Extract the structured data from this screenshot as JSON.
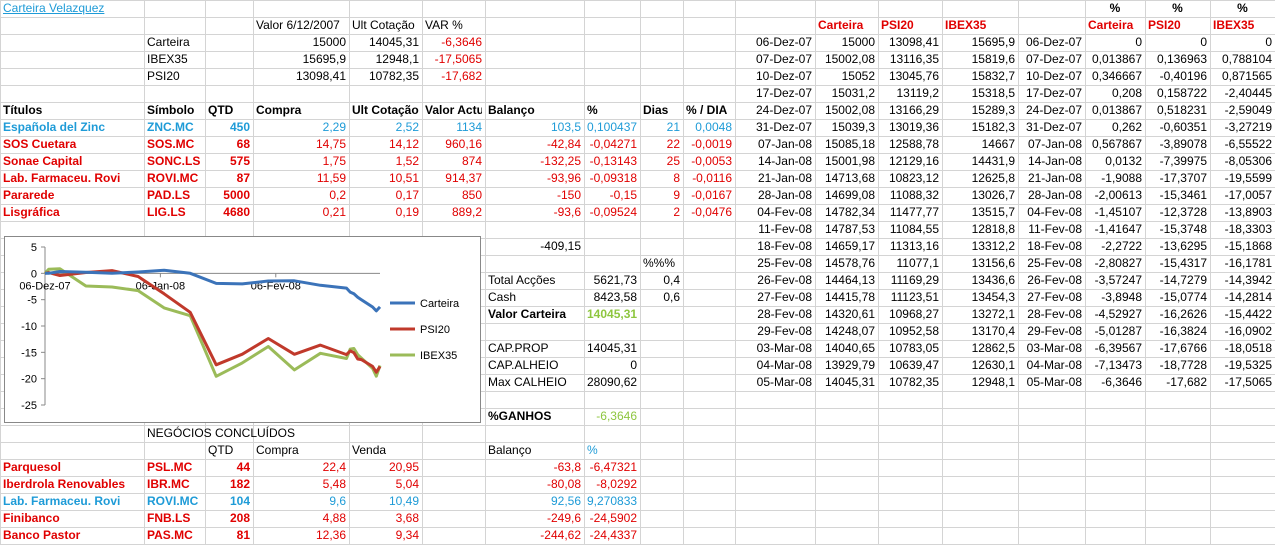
{
  "title": "Carteira Velazquez",
  "summary": {
    "headers": [
      "Valor 6/12/2007",
      "Ult Cotação",
      "VAR %"
    ],
    "rows": [
      {
        "name": "Carteira",
        "valor": "15000",
        "ult": "14045,31",
        "var": "-6,3646"
      },
      {
        "name": "IBEX35",
        "valor": "15695,9",
        "ult": "12948,1",
        "var": "-17,5065"
      },
      {
        "name": "PSI20",
        "valor": "13098,41",
        "ult": "10782,35",
        "var": "-17,682"
      }
    ]
  },
  "titles_headers": [
    "Títulos",
    "Símbolo",
    "QTD",
    "Compra",
    "Ult Cotação",
    "Valor Actual",
    "Balanço",
    "%",
    "Dias",
    "% / DIA"
  ],
  "titles": [
    {
      "name": "Española del Zinc",
      "sym": "ZNC.MC",
      "qtd": "450",
      "compra": "2,29",
      "ult": "2,52",
      "valor": "1134",
      "bal": "103,5",
      "pct": "0,100437",
      "dias": "21",
      "pd": "0,0048",
      "color": "blue"
    },
    {
      "name": "SOS Cuetara",
      "sym": "SOS.MC",
      "qtd": "68",
      "compra": "14,75",
      "ult": "14,12",
      "valor": "960,16",
      "bal": "-42,84",
      "pct": "-0,04271",
      "dias": "22",
      "pd": "-0,0019",
      "color": "red"
    },
    {
      "name": "Sonae Capital",
      "sym": "SONC.LS",
      "qtd": "575",
      "compra": "1,75",
      "ult": "1,52",
      "valor": "874",
      "bal": "-132,25",
      "pct": "-0,13143",
      "dias": "25",
      "pd": "-0,0053",
      "color": "red"
    },
    {
      "name": "Lab. Farmaceu. Rovi",
      "sym": "ROVI.MC",
      "qtd": "87",
      "compra": "11,59",
      "ult": "10,51",
      "valor": "914,37",
      "bal": "-93,96",
      "pct": "-0,09318",
      "dias": "8",
      "pd": "-0,0116",
      "color": "red"
    },
    {
      "name": "Pararede",
      "sym": "PAD.LS",
      "qtd": "5000",
      "compra": "0,2",
      "ult": "0,17",
      "valor": "850",
      "bal": "-150",
      "pct": "-0,15",
      "dias": "9",
      "pd": "-0,0167",
      "color": "red"
    },
    {
      "name": "Lisgráfica",
      "sym": "LIG.LS",
      "qtd": "4680",
      "compra": "0,21",
      "ult": "0,19",
      "valor": "889,2",
      "bal": "-93,6",
      "pct": "-0,09524",
      "dias": "2",
      "pd": "-0,0476",
      "color": "red"
    }
  ],
  "totals": {
    "balance_sum": "-409,15",
    "pctpct_label": "%%%",
    "rows": [
      {
        "label": "Total Acções",
        "value": "5621,73",
        "extra": "0,4"
      },
      {
        "label": "Cash",
        "value": "8423,58",
        "extra": "0,6"
      }
    ],
    "valor_label": "Valor Carteira",
    "valor_value": "14045,31",
    "cap": [
      {
        "label": "CAP.PROP",
        "value": "14045,31"
      },
      {
        "label": "CAP.ALHEIO",
        "value": "0"
      },
      {
        "label": "Max CALHEIO",
        "value": "28090,62"
      }
    ],
    "ganhos_label": "%GANHOS",
    "ganhos_value": "-6,3646"
  },
  "closed": {
    "title": "NEGÓCIOS CONCLUÍDOS",
    "headers": [
      "QTD",
      "Compra",
      "Venda",
      "Balanço",
      "%"
    ],
    "rows": [
      {
        "name": "Parquesol",
        "sym": "PSL.MC",
        "qtd": "44",
        "compra": "22,4",
        "venda": "20,95",
        "bal": "-63,8",
        "pct": "-6,47321",
        "color": "red"
      },
      {
        "name": "Iberdrola Renovables",
        "sym": "IBR.MC",
        "qtd": "182",
        "compra": "5,48",
        "venda": "5,04",
        "bal": "-80,08",
        "pct": "-8,0292",
        "color": "red"
      },
      {
        "name": "Lab. Farmaceu. Rovi",
        "sym": "ROVI.MC",
        "qtd": "104",
        "compra": "9,6",
        "venda": "10,49",
        "bal": "92,56",
        "pct": "9,270833",
        "color": "blue"
      },
      {
        "name": "Finibanco",
        "sym": "FNB.LS",
        "qtd": "208",
        "compra": "4,88",
        "venda": "3,68",
        "bal": "-249,6",
        "pct": "-24,5902",
        "color": "red"
      },
      {
        "name": "Banco Pastor",
        "sym": "PAS.MC",
        "qtd": "81",
        "compra": "12,36",
        "venda": "9,34",
        "bal": "-244,62",
        "pct": "-24,4337",
        "color": "red"
      }
    ]
  },
  "history": {
    "headers": [
      "Carteira",
      "PSI20",
      "IBEX35"
    ],
    "pct_headers": [
      "%",
      "%",
      "%"
    ],
    "rows": [
      {
        "date": "06-Dez-07",
        "c": "15000",
        "p": "13098,41",
        "i": "15695,9",
        "date2": "06-Dez-07",
        "pc": "0",
        "pp": "0",
        "pi": "0"
      },
      {
        "date": "07-Dez-07",
        "c": "15002,08",
        "p": "13116,35",
        "i": "15819,6",
        "date2": "07-Dez-07",
        "pc": "0,013867",
        "pp": "0,136963",
        "pi": "0,788104"
      },
      {
        "date": "10-Dez-07",
        "c": "15052",
        "p": "13045,76",
        "i": "15832,7",
        "date2": "10-Dez-07",
        "pc": "0,346667",
        "pp": "-0,40196",
        "pi": "0,871565"
      },
      {
        "date": "17-Dez-07",
        "c": "15031,2",
        "p": "13119,2",
        "i": "15318,5",
        "date2": "17-Dez-07",
        "pc": "0,208",
        "pp": "0,158722",
        "pi": "-2,40445"
      },
      {
        "date": "24-Dez-07",
        "c": "15002,08",
        "p": "13166,29",
        "i": "15289,3",
        "date2": "24-Dez-07",
        "pc": "0,013867",
        "pp": "0,518231",
        "pi": "-2,59049"
      },
      {
        "date": "31-Dez-07",
        "c": "15039,3",
        "p": "13019,36",
        "i": "15182,3",
        "date2": "31-Dez-07",
        "pc": "0,262",
        "pp": "-0,60351",
        "pi": "-3,27219"
      },
      {
        "date": "07-Jan-08",
        "c": "15085,18",
        "p": "12588,78",
        "i": "14667",
        "date2": "07-Jan-08",
        "pc": "0,567867",
        "pp": "-3,89078",
        "pi": "-6,55522"
      },
      {
        "date": "14-Jan-08",
        "c": "15001,98",
        "p": "12129,16",
        "i": "14431,9",
        "date2": "14-Jan-08",
        "pc": "0,0132",
        "pp": "-7,39975",
        "pi": "-8,05306"
      },
      {
        "date": "21-Jan-08",
        "c": "14713,68",
        "p": "10823,12",
        "i": "12625,8",
        "date2": "21-Jan-08",
        "pc": "-1,9088",
        "pp": "-17,3707",
        "pi": "-19,5599"
      },
      {
        "date": "28-Jan-08",
        "c": "14699,08",
        "p": "11088,32",
        "i": "13026,7",
        "date2": "28-Jan-08",
        "pc": "-2,00613",
        "pp": "-15,3461",
        "pi": "-17,0057"
      },
      {
        "date": "04-Fev-08",
        "c": "14782,34",
        "p": "11477,77",
        "i": "13515,7",
        "date2": "04-Fev-08",
        "pc": "-1,45107",
        "pp": "-12,3728",
        "pi": "-13,8903"
      },
      {
        "date": "11-Fev-08",
        "c": "14787,53",
        "p": "11084,55",
        "i": "12818,8",
        "date2": "11-Fev-08",
        "pc": "-1,41647",
        "pp": "-15,3748",
        "pi": "-18,3303"
      },
      {
        "date": "18-Fev-08",
        "c": "14659,17",
        "p": "11313,16",
        "i": "13312,2",
        "date2": "18-Fev-08",
        "pc": "-2,2722",
        "pp": "-13,6295",
        "pi": "-15,1868"
      },
      {
        "date": "25-Fev-08",
        "c": "14578,76",
        "p": "11077,1",
        "i": "13156,6",
        "date2": "25-Fev-08",
        "pc": "-2,80827",
        "pp": "-15,4317",
        "pi": "-16,1781"
      },
      {
        "date": "26-Fev-08",
        "c": "14464,13",
        "p": "11169,29",
        "i": "13436,6",
        "date2": "26-Fev-08",
        "pc": "-3,57247",
        "pp": "-14,7279",
        "pi": "-14,3942"
      },
      {
        "date": "27-Fev-08",
        "c": "14415,78",
        "p": "11123,51",
        "i": "13454,3",
        "date2": "27-Fev-08",
        "pc": "-3,8948",
        "pp": "-15,0774",
        "pi": "-14,2814"
      },
      {
        "date": "28-Fev-08",
        "c": "14320,61",
        "p": "10968,27",
        "i": "13272,1",
        "date2": "28-Fev-08",
        "pc": "-4,52927",
        "pp": "-16,2626",
        "pi": "-15,4422"
      },
      {
        "date": "29-Fev-08",
        "c": "14248,07",
        "p": "10952,58",
        "i": "13170,4",
        "date2": "29-Fev-08",
        "pc": "-5,01287",
        "pp": "-16,3824",
        "pi": "-16,0902"
      },
      {
        "date": "03-Mar-08",
        "c": "14040,65",
        "p": "10783,05",
        "i": "12862,5",
        "date2": "03-Mar-08",
        "pc": "-6,39567",
        "pp": "-17,6766",
        "pi": "-18,0518"
      },
      {
        "date": "04-Mar-08",
        "c": "13929,79",
        "p": "10639,47",
        "i": "12630,1",
        "date2": "04-Mar-08",
        "pc": "-7,13473",
        "pp": "-18,7728",
        "pi": "-19,5325"
      },
      {
        "date": "05-Mar-08",
        "c": "14045,31",
        "p": "10782,35",
        "i": "12948,1",
        "date2": "05-Mar-08",
        "pc": "-6,3646",
        "pp": "-17,682",
        "pi": "-17,5065"
      }
    ]
  },
  "colors": {
    "carteira": "#3b73b9",
    "psi20": "#c0392b",
    "ibex35": "#9bbb59",
    "red_text": "#e00000",
    "blue_text": "#1e9bd7",
    "green_text": "#8ec63f"
  },
  "chart_data": {
    "type": "line",
    "x": [
      "06-Dez-07",
      "07-Dez-07",
      "10-Dez-07",
      "17-Dez-07",
      "24-Dez-07",
      "31-Dez-07",
      "07-Jan-08",
      "14-Jan-08",
      "21-Jan-08",
      "28-Jan-08",
      "04-Fev-08",
      "11-Fev-08",
      "18-Fev-08",
      "25-Fev-08",
      "26-Fev-08",
      "27-Fev-08",
      "28-Fev-08",
      "29-Fev-08",
      "03-Mar-08",
      "04-Mar-08",
      "05-Mar-08"
    ],
    "x_days": [
      0,
      1,
      4,
      11,
      18,
      25,
      32,
      39,
      46,
      53,
      60,
      67,
      74,
      81,
      82,
      83,
      84,
      85,
      88,
      89,
      90
    ],
    "tick_labels": [
      "06-Dez-07",
      "06-Jan-08",
      "06-Fev-08"
    ],
    "tick_days": [
      0,
      31,
      62
    ],
    "series": [
      {
        "name": "Carteira",
        "values": [
          0,
          0.013867,
          0.346667,
          0.208,
          0.013867,
          0.262,
          0.567867,
          0.0132,
          -1.9088,
          -2.00613,
          -1.45107,
          -1.41647,
          -2.2722,
          -2.80827,
          -3.57247,
          -3.8948,
          -4.52927,
          -5.01287,
          -6.39567,
          -7.13473,
          -6.3646
        ]
      },
      {
        "name": "PSI20",
        "values": [
          0,
          0.136963,
          -0.40196,
          0.158722,
          0.518231,
          -0.60351,
          -3.89078,
          -7.39975,
          -17.3707,
          -15.3461,
          -12.3728,
          -15.3748,
          -13.6295,
          -15.4317,
          -14.7279,
          -15.0774,
          -16.2626,
          -16.3824,
          -17.6766,
          -18.7728,
          -17.682
        ]
      },
      {
        "name": "IBEX35",
        "values": [
          0,
          0.788104,
          0.871565,
          -2.40445,
          -2.59049,
          -3.27219,
          -6.55522,
          -8.05306,
          -19.5599,
          -17.0057,
          -13.8903,
          -18.3303,
          -15.1868,
          -16.1781,
          -14.3942,
          -14.2814,
          -15.4422,
          -16.0902,
          -18.0518,
          -19.5325,
          -17.5065
        ]
      }
    ],
    "yticks": [
      5,
      0,
      -5,
      -10,
      -15,
      -20,
      -25
    ],
    "ylim": [
      -25,
      5
    ],
    "grid": false,
    "legend": "right"
  }
}
